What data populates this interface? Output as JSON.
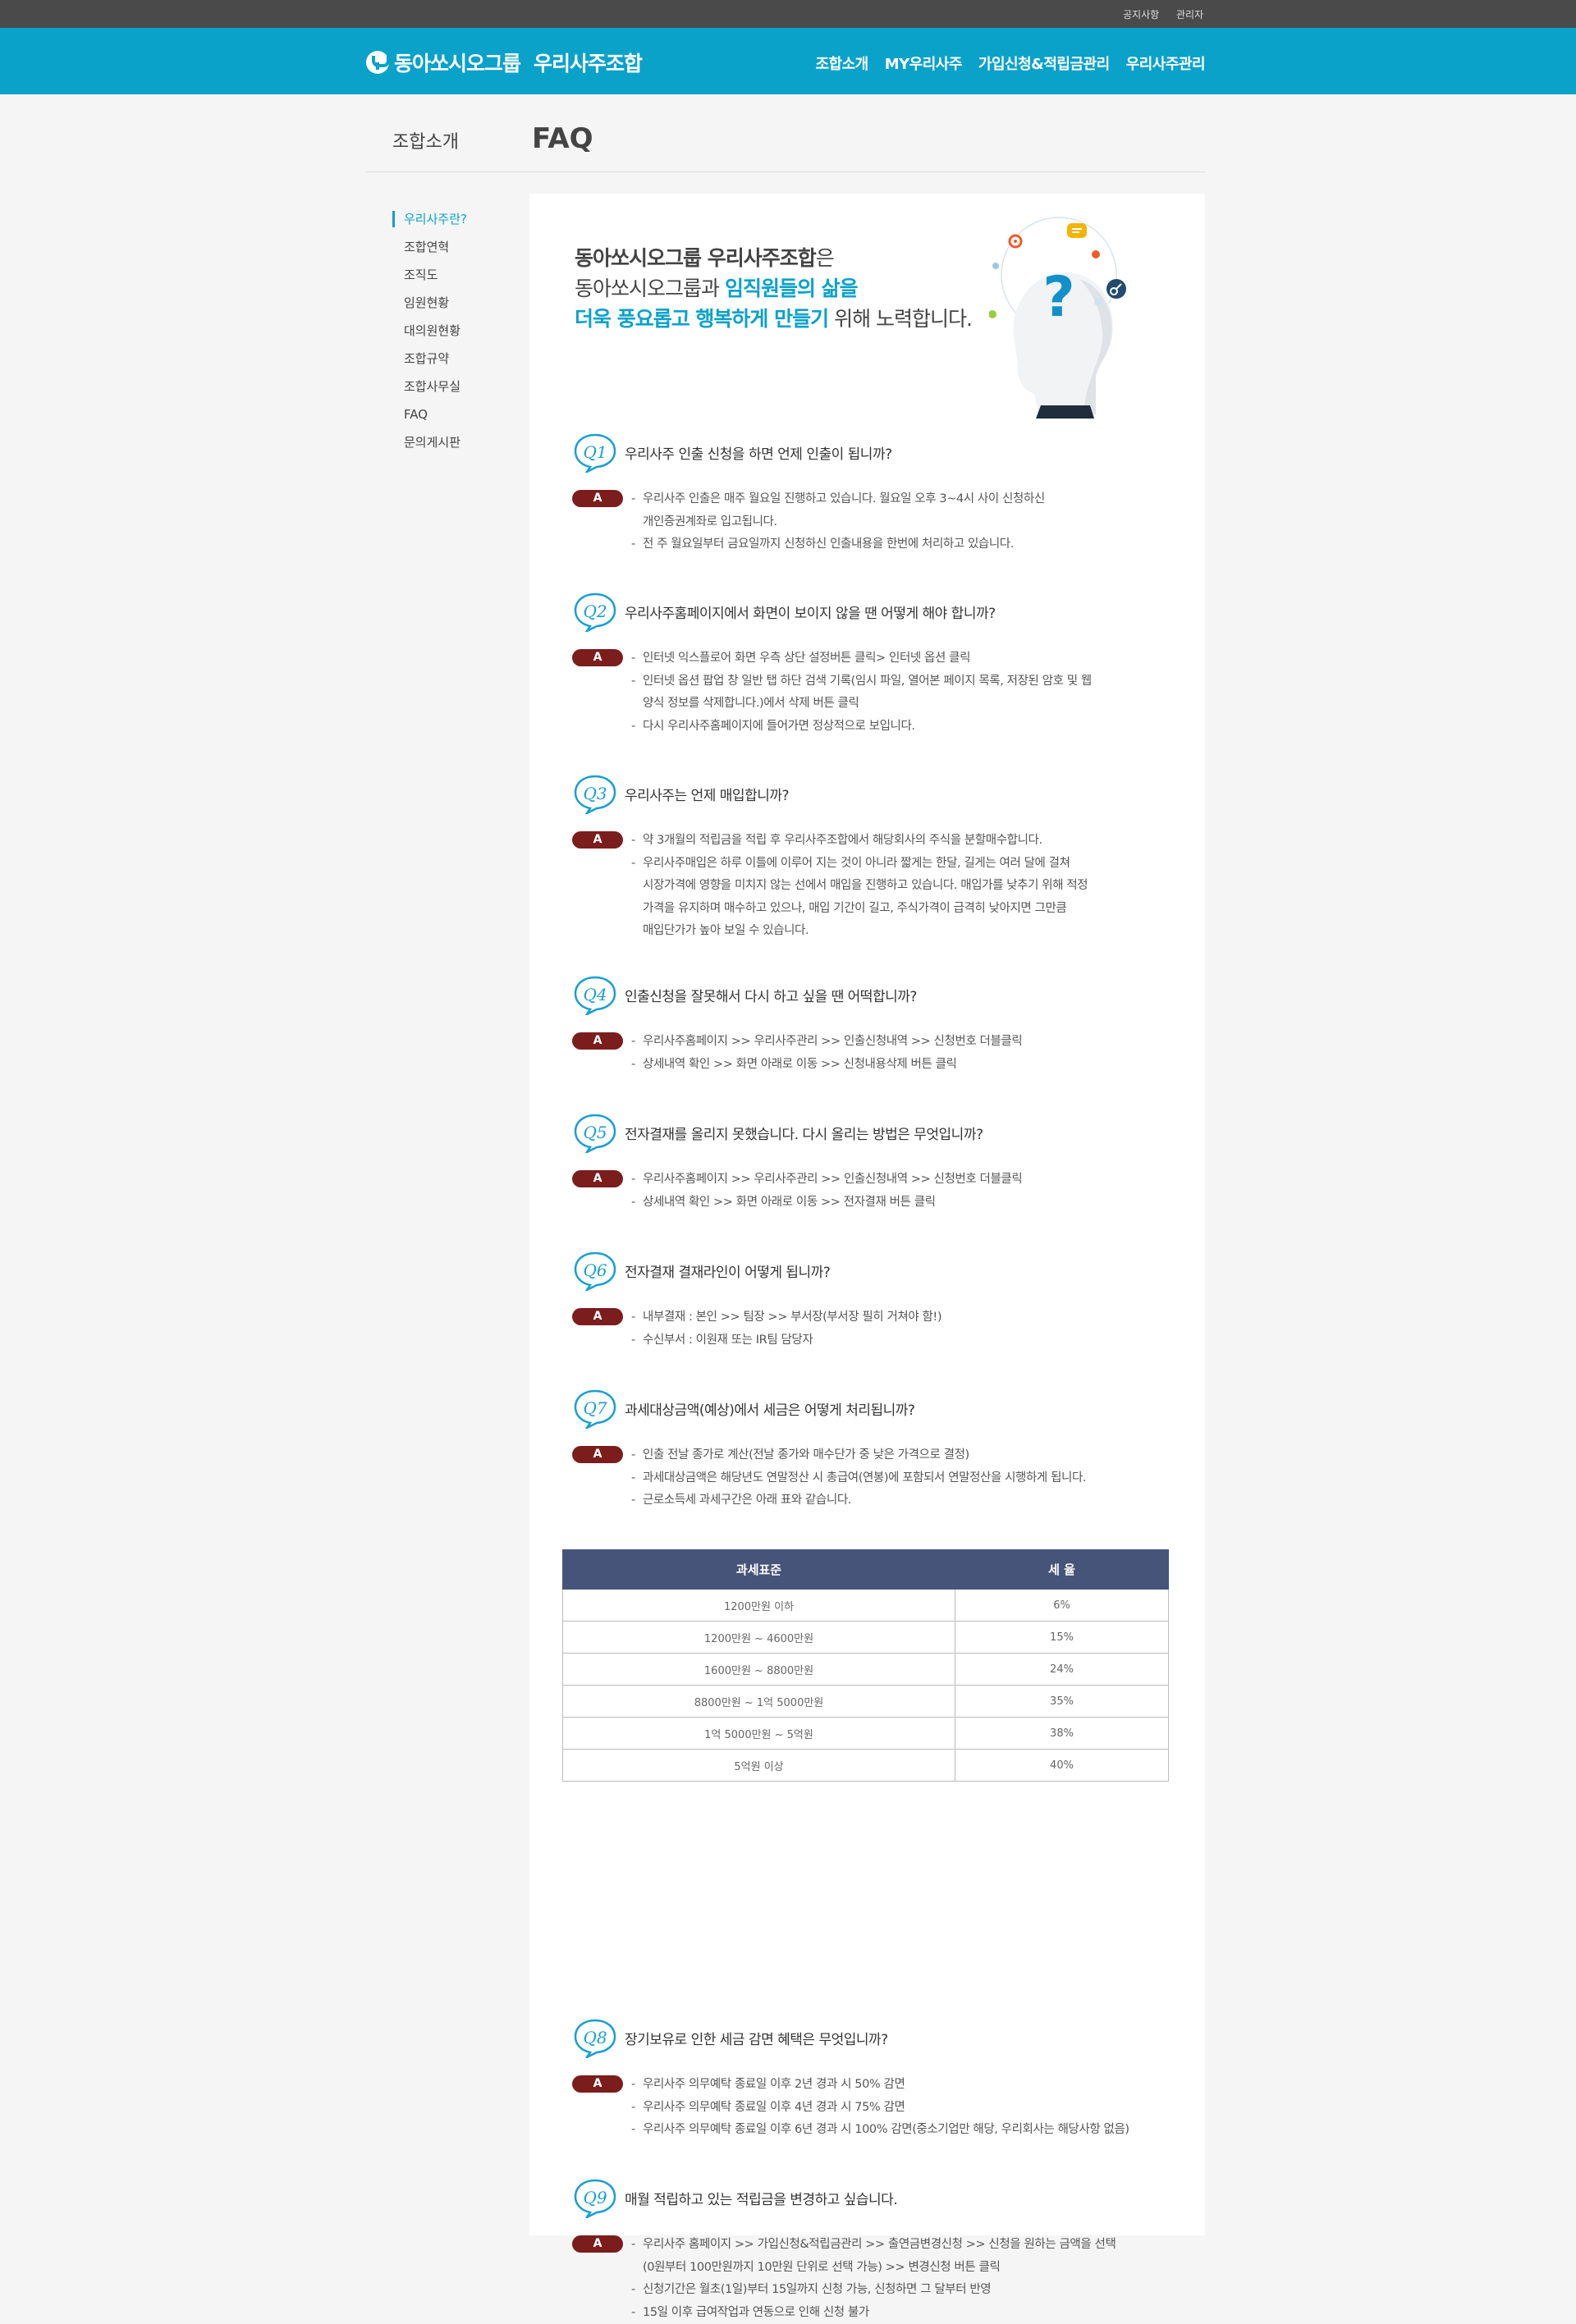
{
  "topbar": {
    "notice": "공지사항",
    "admin": "관리자"
  },
  "header": {
    "logo_group": "동아쏘시오그룹",
    "logo_union": "우리사주조합",
    "nav": [
      "조합소개",
      "MY우리사주",
      "가입신청&적립금관리",
      "우리사주관리"
    ]
  },
  "page": {
    "section": "조합소개",
    "title": "FAQ"
  },
  "lnb": [
    "우리사주란?",
    "조합연혁",
    "조직도",
    "임원현황",
    "대의원현황",
    "조합규약",
    "조합사무실",
    "FAQ",
    "문의게시판"
  ],
  "intro": {
    "l1a": "동아쏘시오그룹 우리사주조합",
    "l1b": "은",
    "l2a": "동아쏘시오그룹과 ",
    "l2b": "임직원들의 삶을",
    "l3a": "더욱 풍요롭고 행복하게 만들기",
    "l3b": " 위해 노력합니다."
  },
  "answer_badge": "A",
  "faqs": [
    {
      "label": "Q1",
      "question": "우리사주 인출 신청을 하면 언제 인출이 됩니까?",
      "lines": [
        {
          "t": "우리사주 인출은 매주 월요일 진행하고 있습니다. 월요일 오후 3~4시 사이 신청하신",
          "d": true
        },
        {
          "t": "개인증권계좌로 입고됩니다.",
          "d": false
        },
        {
          "t": "전 주 월요일부터 금요일까지 신청하신 인출내용을 한번에 처리하고 있습니다.",
          "d": true
        }
      ]
    },
    {
      "label": "Q2",
      "question": "우리사주홈페이지에서 화면이 보이지 않을 땐 어떻게 해야 합니까?",
      "lines": [
        {
          "t": "인터넷 익스플로어 화면 우측 상단 설정버튼 클릭> 인터넷 옵션 클릭",
          "d": true
        },
        {
          "t": "인터넷 옵션 팝업 창 일반 탭 하단 검색 기록(임시 파일, 열어본 페이지 목록, 저장된 암호 및 웹",
          "d": true
        },
        {
          "t": "양식 정보를 삭제합니다.)에서 삭제 버튼 클릭",
          "d": false
        },
        {
          "t": "다시 우리사주홈페이지에 들어가면 정상적으로 보입니다.",
          "d": true
        }
      ]
    },
    {
      "label": "Q3",
      "question": "우리사주는 언제 매입합니까?",
      "lines": [
        {
          "t": "약 3개월의 적립금을 적립 후 우리사주조합에서 해당회사의 주식을 분할매수합니다.",
          "d": true
        },
        {
          "t": "우리사주매입은 하루 이틀에 이루어 지는 것이 아니라 짧게는 한달, 길게는 여러 달에 걸쳐",
          "d": true
        },
        {
          "t": "시장가격에 영향을 미치지 않는 선에서 매입을 진행하고 있습니다. 매입가를 낮추기 위해 적정",
          "d": false
        },
        {
          "t": "가격을 유지하며 매수하고 있으나, 매입 기간이 길고, 주식가격이 급격히 낮아지면 그만큼",
          "d": false
        },
        {
          "t": "매입단가가 높아 보일 수 있습니다.",
          "d": false
        }
      ]
    },
    {
      "label": "Q4",
      "question": "인출신청을 잘못해서 다시 하고 싶을 땐 어떡합니까?",
      "lines": [
        {
          "t": "우리사주홈페이지 >> 우리사주관리 >> 인출신청내역 >> 신청번호 더블클릭",
          "d": true
        },
        {
          "t": "상세내역 확인 >> 화면 아래로 이동 >> 신청내용삭제 버튼 클릭",
          "d": true
        }
      ]
    },
    {
      "label": "Q5",
      "question": "전자결재를 올리지 못했습니다. 다시 올리는 방법은 무엇입니까?",
      "lines": [
        {
          "t": "우리사주홈페이지 >> 우리사주관리 >> 인출신청내역 >> 신청번호 더블클릭",
          "d": true
        },
        {
          "t": "상세내역 확인 >> 화면 아래로 이동 >> 전자결재 버튼 클릭",
          "d": true
        }
      ]
    },
    {
      "label": "Q6",
      "question": "전자결재 결재라인이 어떻게 됩니까?",
      "lines": [
        {
          "t": "내부결재 : 본인 >> 팀장 >> 부서장(부서장 필히 거쳐야 함!)",
          "d": true
        },
        {
          "t": "수신부서 : 이원재 또는 IR팀 담당자",
          "d": true
        }
      ]
    },
    {
      "label": "Q7",
      "question": "과세대상금액(예상)에서 세금은 어떻게 처리됩니까?",
      "lines": [
        {
          "t": "인출 전날 종가로 계산(전날 종가와 매수단가 중 낮은 가격으로 결정)",
          "d": true
        },
        {
          "t": "과세대상금액은 해당년도 연말정산 시 총급여(연봉)에 포함되서 연말정산을 시행하게 됩니다.",
          "d": true
        },
        {
          "t": "근로소득세 과세구간은 아래 표와 같습니다.",
          "d": true
        }
      ]
    },
    {
      "label": "Q8",
      "question": "장기보유로 인한 세금 감면 혜택은 무엇입니까?",
      "lines": [
        {
          "t": "우리사주 의무예탁 종료일 이후 2년 경과 시 50% 감면",
          "d": true
        },
        {
          "t": "우리사주 의무예탁 종료일 이후 4년 경과 시 75% 감면",
          "d": true
        },
        {
          "t": "우리사주 의무예탁 종료일 이후 6년 경과 시 100% 감면(중소기업만 해당, 우리회사는 해당사항 없음)",
          "d": true
        }
      ]
    },
    {
      "label": "Q9",
      "question": "매월 적립하고 있는 적립금을 변경하고 싶습니다.",
      "lines": [
        {
          "t": "우리사주 홈페이지 >> 가입신청&적립금관리 >> 출연금변경신청 >> 신청을 원하는 금액을 선택",
          "d": true
        },
        {
          "t": "(0원부터 100만원까지 10만원 단위로 선택 가능) >> 변경신청 버튼 클릭",
          "d": false
        },
        {
          "t": "신청기간은 월초(1일)부터 15일까지 신청 가능, 신청하면 그 달부터 반영",
          "d": true
        },
        {
          "t": "15일 이후 급여작업과 연동으로 인해 신청 불가",
          "d": true
        }
      ]
    }
  ],
  "tax_table": {
    "headers": [
      "과세표준",
      "세 율"
    ],
    "rows": [
      [
        "1200만원 이하",
        "6%"
      ],
      [
        "1200만원 ~ 4600만원",
        "15%"
      ],
      [
        "1600만원 ~ 8800만원",
        "24%"
      ],
      [
        "8800만원 ~ 1억 5000만원",
        "35%"
      ],
      [
        "1억 5000만원 ~ 5억원",
        "38%"
      ],
      [
        "5억원 이상",
        "40%"
      ]
    ]
  },
  "colors": {
    "brand": "#0aa2c9",
    "answer_badge": "#7b1d1d",
    "table_header": "#465479"
  }
}
